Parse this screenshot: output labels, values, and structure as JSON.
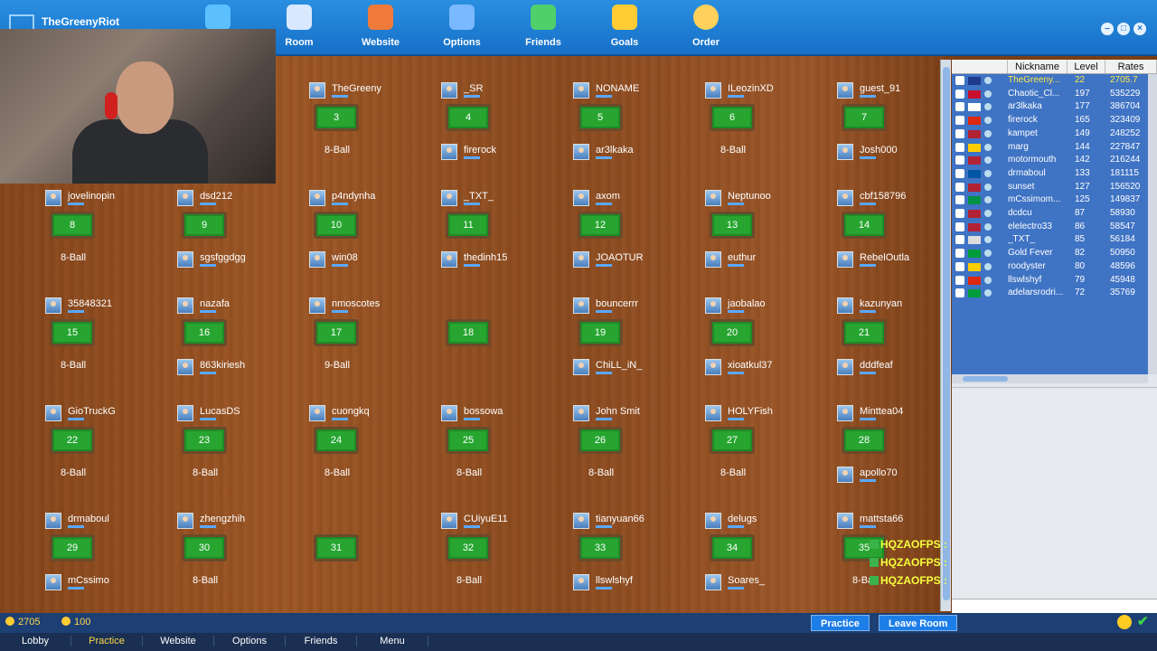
{
  "brand": {
    "name": "TheGreenyRiot"
  },
  "nav": [
    {
      "label": "",
      "icon": "runner-icon"
    },
    {
      "label": "Room",
      "icon": "controller-icon"
    },
    {
      "label": "Website",
      "icon": "house-icon"
    },
    {
      "label": "Options",
      "icon": "gear-icon"
    },
    {
      "label": "Friends",
      "icon": "friends-icon"
    },
    {
      "label": "Goals",
      "icon": "goals-icon"
    },
    {
      "label": "Order",
      "icon": "pie-icon"
    }
  ],
  "tables": [
    {
      "num": "3",
      "top": "TheGreeny",
      "bottom": "",
      "type": "8-Ball"
    },
    {
      "num": "4",
      "top": "_SR",
      "bottom": "firerock",
      "type": ""
    },
    {
      "num": "5",
      "top": "NONAME",
      "bottom": "ar3lkaka",
      "type": ""
    },
    {
      "num": "6",
      "top": "ILeozinXD",
      "bottom": "",
      "type": "8-Ball"
    },
    {
      "num": "7",
      "top": "guest_91",
      "bottom": "Josh000",
      "type": ""
    },
    {
      "num": "8",
      "top": "jovelinopin",
      "bottom": "",
      "type": "8-Ball"
    },
    {
      "num": "9",
      "top": "dsd212",
      "bottom": "sgsfggdgg",
      "type": ""
    },
    {
      "num": "10",
      "top": "p4ndynha",
      "bottom": "win08",
      "type": ""
    },
    {
      "num": "11",
      "top": "_TXT_",
      "bottom": "thedinh15",
      "type": ""
    },
    {
      "num": "12",
      "top": "axom",
      "bottom": "JOAOTUR",
      "type": ""
    },
    {
      "num": "13",
      "top": "Neptunoo",
      "bottom": "euthur",
      "type": ""
    },
    {
      "num": "14",
      "top": "cbf158796",
      "bottom": "RebelOutla",
      "type": ""
    },
    {
      "num": "15",
      "top": "35848321",
      "bottom": "",
      "type": "8-Ball"
    },
    {
      "num": "16",
      "top": "nazafa",
      "bottom": "863kiriesh",
      "type": ""
    },
    {
      "num": "17",
      "top": "nmoscotes",
      "bottom": "",
      "type": "9-Ball"
    },
    {
      "num": "18",
      "top": "",
      "bottom": "",
      "type": ""
    },
    {
      "num": "19",
      "top": "bouncerrr",
      "bottom": "ChiLL_iN_",
      "type": ""
    },
    {
      "num": "20",
      "top": "jaobalao",
      "bottom": "xioatkul37",
      "type": ""
    },
    {
      "num": "21",
      "top": "kazunyan",
      "bottom": "dddfeaf",
      "type": ""
    },
    {
      "num": "22",
      "top": "GioTruckG",
      "bottom": "",
      "type": "8-Ball"
    },
    {
      "num": "23",
      "top": "LucasDS",
      "bottom": "",
      "type": "8-Ball"
    },
    {
      "num": "24",
      "top": "cuongkq",
      "bottom": "",
      "type": "8-Ball"
    },
    {
      "num": "25",
      "top": "bossowa",
      "bottom": "",
      "type": "8-Ball"
    },
    {
      "num": "26",
      "top": "John Smit",
      "bottom": "",
      "type": "8-Ball"
    },
    {
      "num": "27",
      "top": "HOLYFish",
      "bottom": "",
      "type": "8-Ball"
    },
    {
      "num": "28",
      "top": "Minttea04",
      "bottom": "apollo70",
      "type": ""
    },
    {
      "num": "29",
      "top": "drmaboul",
      "bottom": "mCssimo",
      "type": ""
    },
    {
      "num": "30",
      "top": "zhengzhih",
      "bottom": "",
      "type": "8-Ball"
    },
    {
      "num": "31",
      "top": "",
      "bottom": "",
      "type": ""
    },
    {
      "num": "32",
      "top": "CUiyuE11",
      "bottom": "",
      "type": "8-Ball"
    },
    {
      "num": "33",
      "top": "tianyuan66",
      "bottom": "llswlshyf",
      "type": ""
    },
    {
      "num": "34",
      "top": "delugs",
      "bottom": "Soares_",
      "type": ""
    },
    {
      "num": "35",
      "top": "mattsta66",
      "bottom": "",
      "type": "8-Ball"
    }
  ],
  "userlist": {
    "headers": [
      "Nickname",
      "Level",
      "Rates"
    ],
    "rows": [
      {
        "nick": "TheGreeny...",
        "level": "22",
        "rate": "2705.7",
        "me": true
      },
      {
        "nick": "Chaotic_Cl...",
        "level": "197",
        "rate": "535229"
      },
      {
        "nick": "ar3lkaka",
        "level": "177",
        "rate": "386704"
      },
      {
        "nick": "firerock",
        "level": "165",
        "rate": "323409"
      },
      {
        "nick": "kampet",
        "level": "149",
        "rate": "248252"
      },
      {
        "nick": "marg",
        "level": "144",
        "rate": "227847"
      },
      {
        "nick": "motormouth",
        "level": "142",
        "rate": "216244"
      },
      {
        "nick": "drmaboul",
        "level": "133",
        "rate": "181115"
      },
      {
        "nick": "sunset",
        "level": "127",
        "rate": "156520"
      },
      {
        "nick": "mCssimom...",
        "level": "125",
        "rate": "149837"
      },
      {
        "nick": "dcdcu",
        "level": "87",
        "rate": "58930"
      },
      {
        "nick": "elelectro33",
        "level": "86",
        "rate": "58547"
      },
      {
        "nick": "_TXT_",
        "level": "85",
        "rate": "56184"
      },
      {
        "nick": "Gold Fever",
        "level": "82",
        "rate": "50950"
      },
      {
        "nick": "roodyster",
        "level": "80",
        "rate": "48596"
      },
      {
        "nick": "llswlshyf",
        "level": "79",
        "rate": "45948"
      },
      {
        "nick": "adelarsrodri...",
        "level": "72",
        "rate": "35769"
      }
    ]
  },
  "toasts": [
    "HQZAOFPS :",
    "HQZAOFPS :",
    "HQZAOFPS :"
  ],
  "status": {
    "stars": "2705",
    "coins": "100"
  },
  "buttons": {
    "practice": "Practice",
    "leave": "Leave Room"
  },
  "tabs": [
    {
      "label": "Lobby",
      "active": false
    },
    {
      "label": "Practice",
      "active": true
    },
    {
      "label": "Website",
      "active": false
    },
    {
      "label": "Options",
      "active": false
    },
    {
      "label": "Friends",
      "active": false
    },
    {
      "label": "Menu",
      "active": false
    }
  ],
  "colors": {
    "accent": "#1670c8",
    "felt": "#27a530",
    "wood": "#8b4a1e",
    "highlight": "#ffe94a"
  }
}
